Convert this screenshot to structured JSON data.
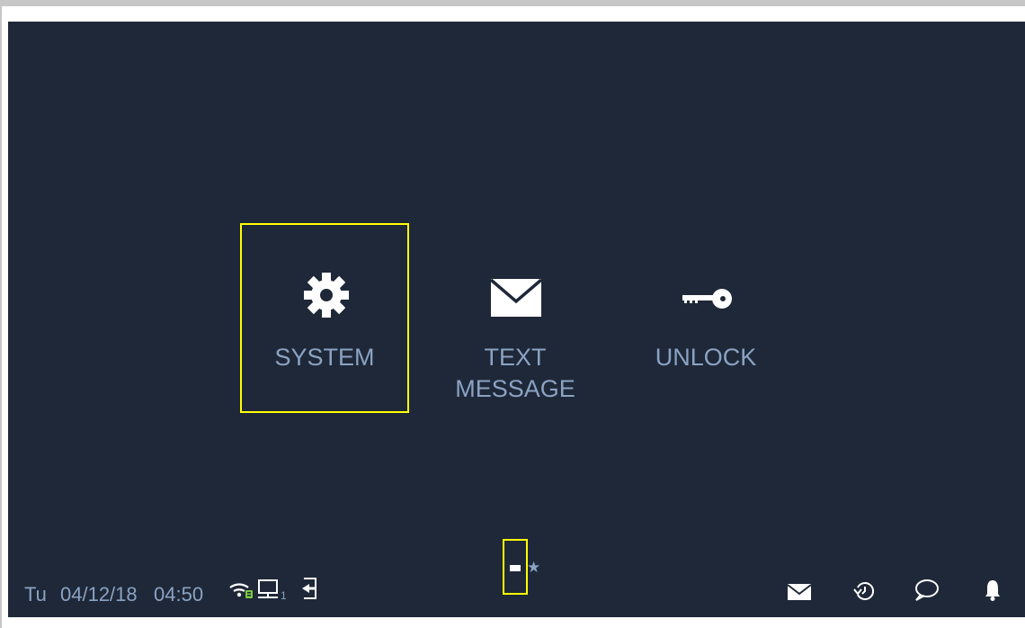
{
  "tiles": [
    {
      "label": "SYSTEM",
      "icon": "gear-icon",
      "selected": true
    },
    {
      "label": "TEXT\nMESSAGE",
      "icon": "envelope-icon",
      "selected": false
    },
    {
      "label": "UNLOCK",
      "icon": "key-icon",
      "selected": false
    }
  ],
  "status_bar": {
    "day": "Tu",
    "date": "04/12/18",
    "time": "04:50",
    "network_index": "1"
  },
  "pager": {
    "current_page": 1,
    "pages": 2
  },
  "colors": {
    "background": "#1f2838",
    "label": "#8aa3c3",
    "icon": "#ffffff",
    "selection": "#ffff00",
    "wifi": "#7ac943"
  }
}
